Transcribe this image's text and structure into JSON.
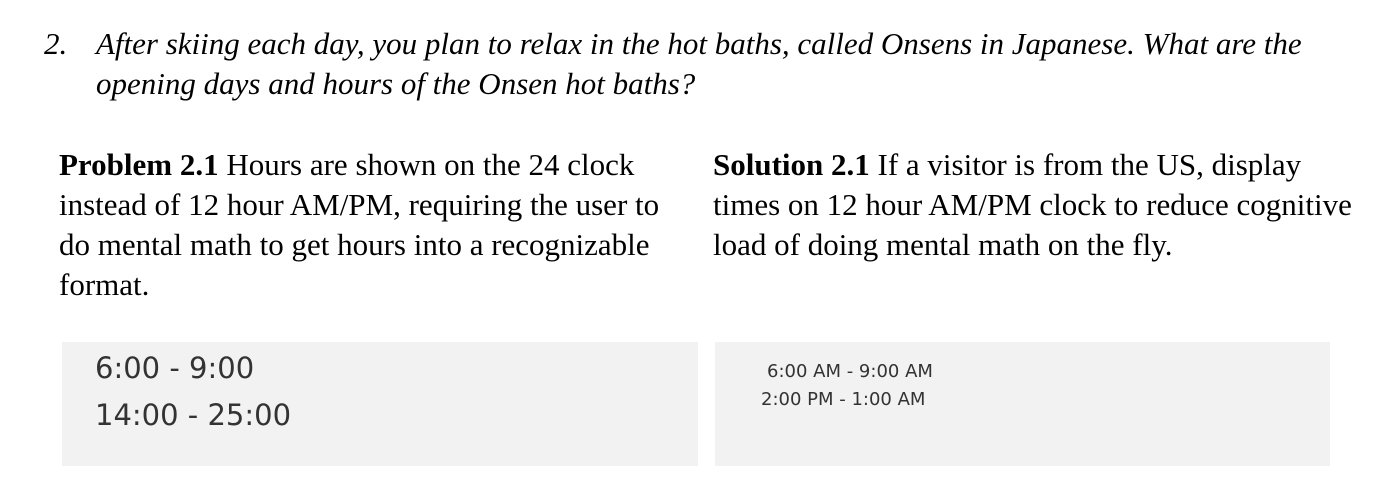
{
  "question": {
    "number": "2.",
    "text": "After skiing each day, you plan to relax in the hot baths, called Onsens in Japanese. What are the opening days and hours of the Onsen hot baths?"
  },
  "problem": {
    "label": "Problem 2.1",
    "text": " Hours are shown on the 24 clock instead of 12 hour AM/PM, requiring the user to do mental math to get hours into a recognizable format."
  },
  "solution": {
    "label": "Solution 2.1",
    "text": " If a visitor is from the US, display times on 12 hour AM/PM clock to reduce cognitive load of doing mental math on the fly."
  },
  "problem_example": {
    "hours": [
      "6:00 - 9:00",
      "14:00 - 25:00"
    ]
  },
  "solution_example": {
    "hours": [
      "6:00 AM - 9:00 AM",
      "2:00 PM - 1:00 AM"
    ]
  }
}
